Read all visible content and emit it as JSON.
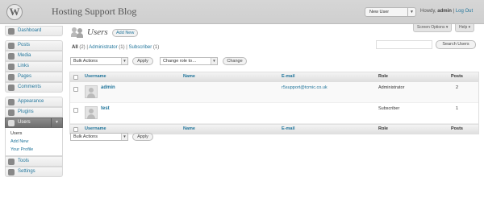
{
  "header": {
    "site_title": "Hosting Support Blog",
    "favorite_action": "New User",
    "howdy": "Howdy,",
    "username": "admin",
    "log_out": "Log Out"
  },
  "screen_meta": {
    "screen_options": "Screen Options ▾",
    "help": "Help ▾"
  },
  "sidebar": {
    "items": [
      {
        "label": "Dashboard"
      },
      {
        "label": "Posts"
      },
      {
        "label": "Media"
      },
      {
        "label": "Links"
      },
      {
        "label": "Pages"
      },
      {
        "label": "Comments"
      },
      {
        "label": "Appearance"
      },
      {
        "label": "Plugins"
      },
      {
        "label": "Users"
      },
      {
        "label": "Tools"
      },
      {
        "label": "Settings"
      }
    ],
    "users_submenu": [
      "Users",
      "Add New",
      "Your Profile"
    ]
  },
  "main": {
    "title": "Users",
    "add_new": "Add New",
    "filters": {
      "all": "All",
      "all_count": "(2)",
      "administrator": "Administrator",
      "administrator_count": "(1)",
      "subscriber": "Subscriber",
      "subscriber_count": "(1)",
      "sep": "|"
    },
    "search_button": "Search Users",
    "bulk_actions": "Bulk Actions",
    "apply": "Apply",
    "change_role": "Change role to…",
    "change": "Change",
    "columns": [
      "Username",
      "Name",
      "E-mail",
      "Role",
      "Posts"
    ],
    "rows": [
      {
        "username": "admin",
        "name": "",
        "email": "r5support@tcrnic.co.uk",
        "role": "Administrator",
        "posts": "2"
      },
      {
        "username": "test",
        "name": "",
        "email": "",
        "role": "Subscriber",
        "posts": "1"
      }
    ]
  },
  "icons": [
    "wordpress-logo-icon",
    "users-icon",
    "dashboard-icon",
    "posts-icon",
    "media-icon",
    "links-icon",
    "pages-icon",
    "comments-icon",
    "appearance-icon",
    "plugins-icon",
    "tools-icon",
    "settings-icon"
  ]
}
